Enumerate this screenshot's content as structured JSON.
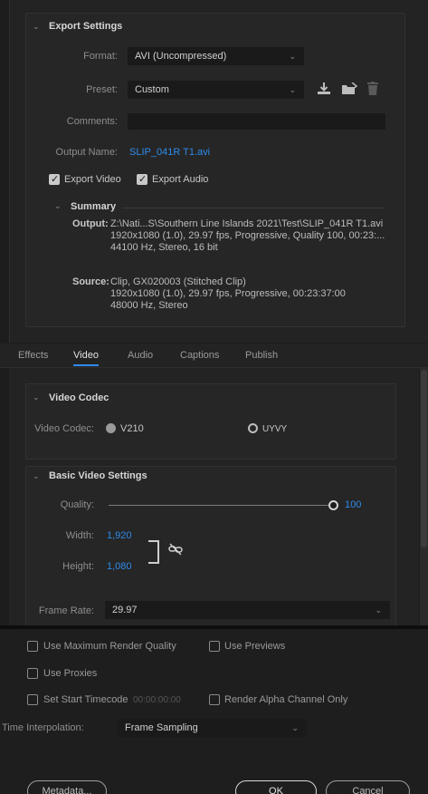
{
  "export_settings": {
    "title": "Export Settings",
    "format_label": "Format:",
    "format_value": "AVI (Uncompressed)",
    "preset_label": "Preset:",
    "preset_value": "Custom",
    "comments_label": "Comments:",
    "comments_value": "",
    "output_name_label": "Output Name:",
    "output_name_value": "SLIP_041R T1.avi",
    "export_video_label": "Export Video",
    "export_video_checked": true,
    "export_audio_label": "Export Audio",
    "export_audio_checked": true
  },
  "summary": {
    "title": "Summary",
    "output_label": "Output:",
    "output_lines": [
      "Z:\\Nati...S\\Southern Line Islands 2021\\Test\\SLIP_041R T1.avi",
      "1920x1080 (1.0), 29.97 fps, Progressive, Quality 100, 00:23:...",
      "44100 Hz, Stereo, 16 bit"
    ],
    "source_label": "Source:",
    "source_lines": [
      "Clip, GX020003 (Stitched Clip)",
      "1920x1080 (1.0), 29.97 fps, Progressive, 00:23:37:00",
      "48000 Hz, Stereo"
    ]
  },
  "tabs": [
    {
      "label": "Effects",
      "active": false
    },
    {
      "label": "Video",
      "active": true
    },
    {
      "label": "Audio",
      "active": false
    },
    {
      "label": "Captions",
      "active": false
    },
    {
      "label": "Publish",
      "active": false
    }
  ],
  "video_codec": {
    "title": "Video Codec",
    "label": "Video Codec:",
    "options": [
      {
        "label": "V210",
        "selected": true
      },
      {
        "label": "UYVY",
        "selected": false
      }
    ]
  },
  "basic_video": {
    "title": "Basic Video Settings",
    "quality_label": "Quality:",
    "quality_value": "100",
    "quality_fraction": 1.0,
    "width_label": "Width:",
    "width_value": "1,920",
    "height_label": "Height:",
    "height_value": "1,080",
    "frame_rate_label": "Frame Rate:",
    "frame_rate_value": "29.97"
  },
  "bottom_options": {
    "max_render_quality": "Use Maximum Render Quality",
    "use_previews": "Use Previews",
    "use_proxies": "Use Proxies",
    "set_start_timecode": "Set Start Timecode",
    "timecode_value": "00:00:00:00",
    "render_alpha_only": "Render Alpha Channel Only",
    "time_interpolation_label": "Time Interpolation:",
    "time_interpolation_value": "Frame Sampling"
  },
  "buttons": {
    "metadata": "Metadata...",
    "ok": "OK",
    "cancel": "Cancel"
  },
  "colors": {
    "accent": "#2d8ceb",
    "background": "#1d1d1d"
  }
}
